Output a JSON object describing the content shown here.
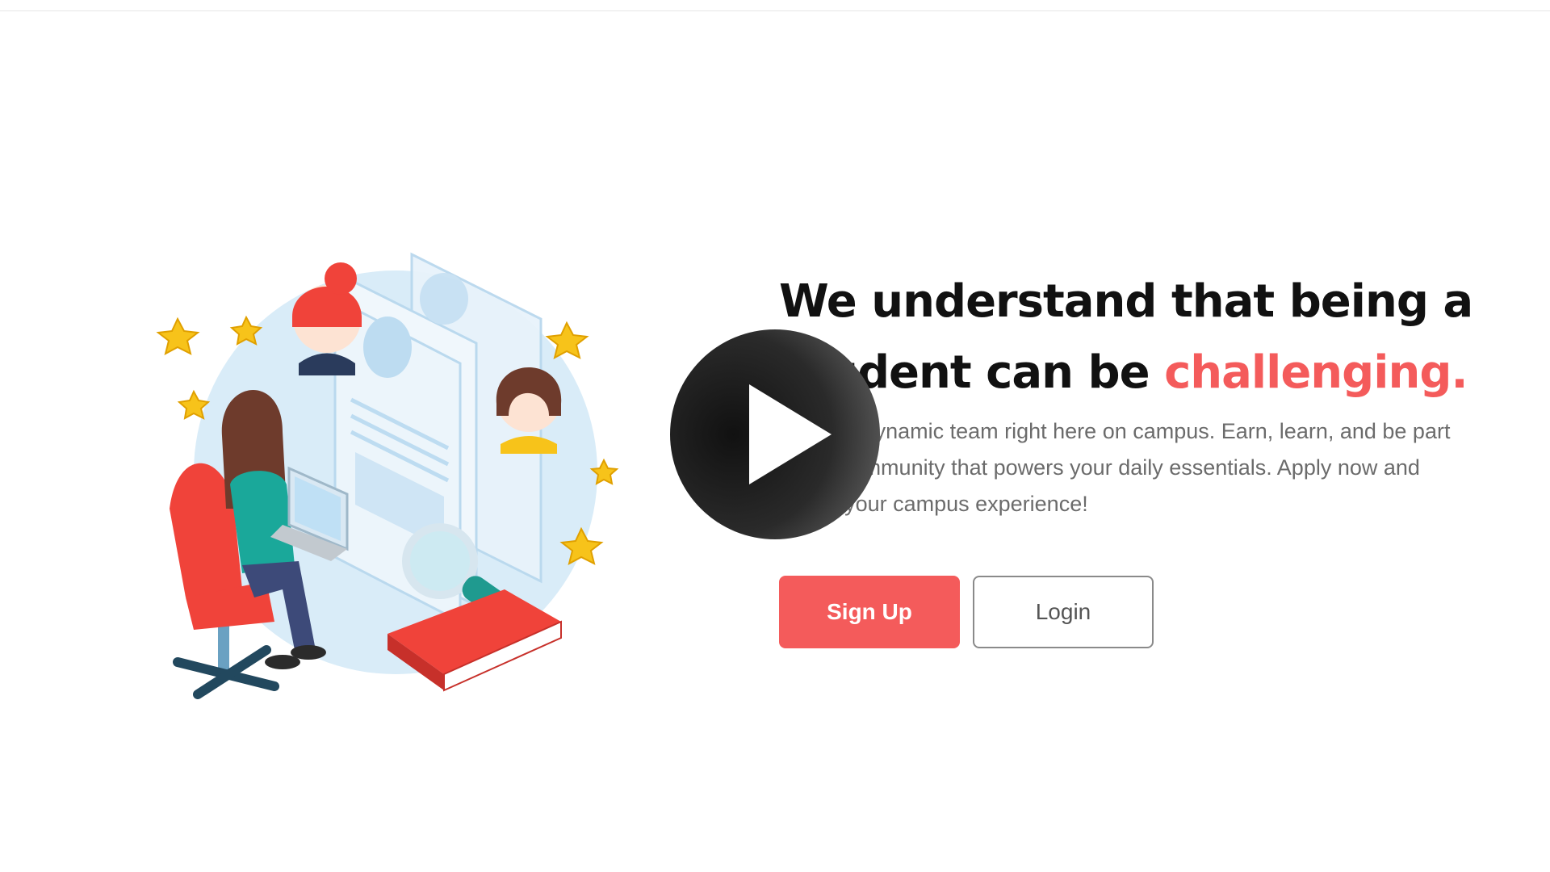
{
  "hero": {
    "headline_part1": "We understand that being a student can be ",
    "headline_accent": "challenging.",
    "body": "Join our dynamic team right here on campus. Earn, learn, and be part of the community that powers your daily essentials. Apply now and shape your campus experience!"
  },
  "actions": {
    "signup_label": "Sign Up",
    "login_label": "Login"
  },
  "colors": {
    "accent": "#f45b5b",
    "headline": "#111111",
    "body_text": "#6b6b6b"
  },
  "overlay": {
    "icon": "play-icon"
  },
  "illustration": {
    "icon": "student-job-application-illustration"
  }
}
